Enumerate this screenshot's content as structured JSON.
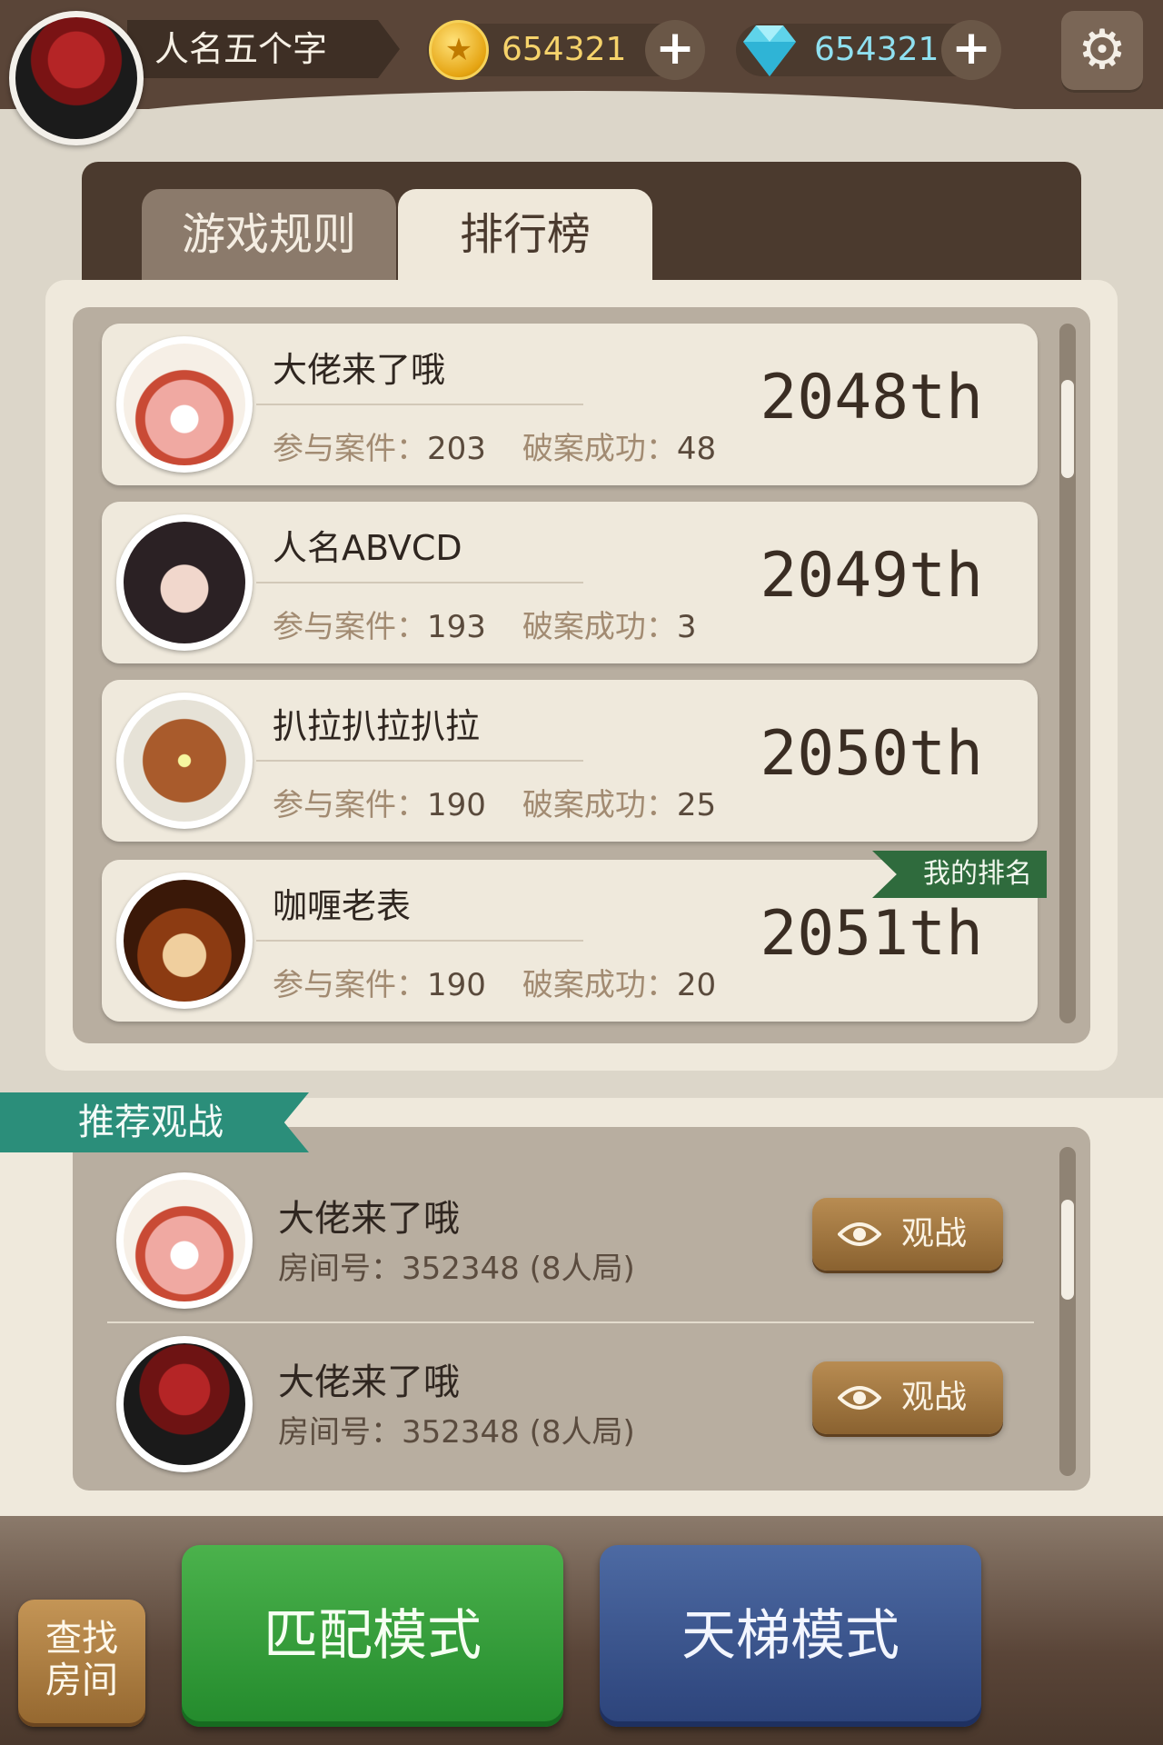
{
  "header": {
    "username": "人名五个字",
    "coins": "654321",
    "gems": "654321",
    "coin_icon": "coin-star-icon",
    "gem_icon": "diamond-icon",
    "settings_icon": "gear-icon"
  },
  "tabs": [
    {
      "label": "游戏规则",
      "active": false
    },
    {
      "label": "排行榜",
      "active": true
    }
  ],
  "leaderboard": {
    "participated_label": "参与案件：",
    "solved_label": "破案成功：",
    "my_rank_badge": "我的排名",
    "entries": [
      {
        "name": "大佬来了哦",
        "participated": "203",
        "solved": "48",
        "rank": "2048th"
      },
      {
        "name": "人名ABVCD",
        "participated": "193",
        "solved": "3",
        "rank": "2049th"
      },
      {
        "name": "扒拉扒拉扒拉",
        "participated": "190",
        "solved": "25",
        "rank": "2050th"
      },
      {
        "name": "咖喱老表",
        "participated": "190",
        "solved": "20",
        "rank": "2051th",
        "is_me": true
      }
    ]
  },
  "watch": {
    "title": "推荐观战",
    "room_label": "房间号：",
    "button_label": "观战",
    "items": [
      {
        "name": "大佬来了哦",
        "room": "352348 (8人局)"
      },
      {
        "name": "大佬来了哦",
        "room": "352348 (8人局)"
      }
    ]
  },
  "footer": {
    "find_room_line1": "查找",
    "find_room_line2": "房间",
    "match_mode": "匹配模式",
    "ladder_mode": "天梯模式"
  },
  "colors": {
    "header_bg": "#5a4538",
    "accent_green": "#2f6b3d",
    "teal": "#2b8e7a",
    "match_green": "#3aa23f",
    "ladder_blue": "#3d5890",
    "gold": "#f6d36b"
  }
}
